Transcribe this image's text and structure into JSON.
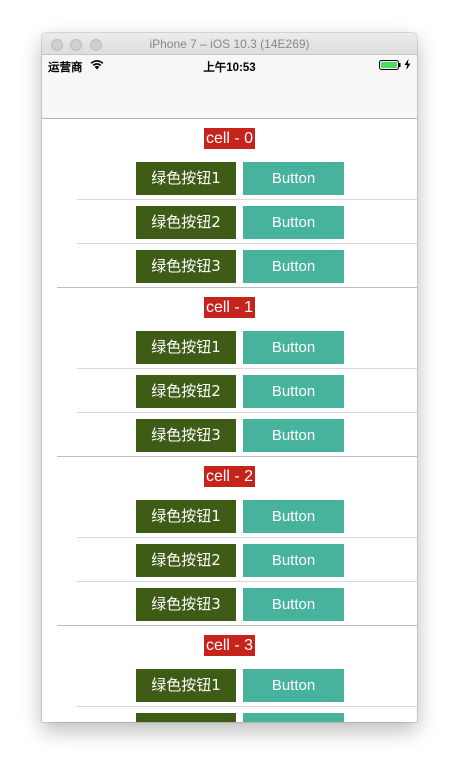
{
  "window": {
    "title": "iPhone 7 – iOS 10.3 (14E269)"
  },
  "statusbar": {
    "carrier": "运营商",
    "time": "上午10:53",
    "wifi_icon": "wifi-icon",
    "battery_icon": "battery-icon",
    "charging_icon": "bolt-icon",
    "battery_color": "#4cd964"
  },
  "colors": {
    "cell_label_bg": "#c7231d",
    "green_button": "#3f5c17",
    "teal_button": "#47b39c"
  },
  "sections": [
    {
      "label": "cell - 0",
      "rows": [
        {
          "green_label": "绿色按钮1",
          "button_label": "Button"
        },
        {
          "green_label": "绿色按钮2",
          "button_label": "Button"
        },
        {
          "green_label": "绿色按钮3",
          "button_label": "Button"
        }
      ]
    },
    {
      "label": "cell - 1",
      "rows": [
        {
          "green_label": "绿色按钮1",
          "button_label": "Button"
        },
        {
          "green_label": "绿色按钮2",
          "button_label": "Button"
        },
        {
          "green_label": "绿色按钮3",
          "button_label": "Button"
        }
      ]
    },
    {
      "label": "cell - 2",
      "rows": [
        {
          "green_label": "绿色按钮1",
          "button_label": "Button"
        },
        {
          "green_label": "绿色按钮2",
          "button_label": "Button"
        },
        {
          "green_label": "绿色按钮3",
          "button_label": "Button"
        }
      ]
    },
    {
      "label": "cell - 3",
      "rows": [
        {
          "green_label": "绿色按钮1",
          "button_label": "Button"
        },
        {
          "green_label": "",
          "button_label": ""
        }
      ]
    }
  ]
}
